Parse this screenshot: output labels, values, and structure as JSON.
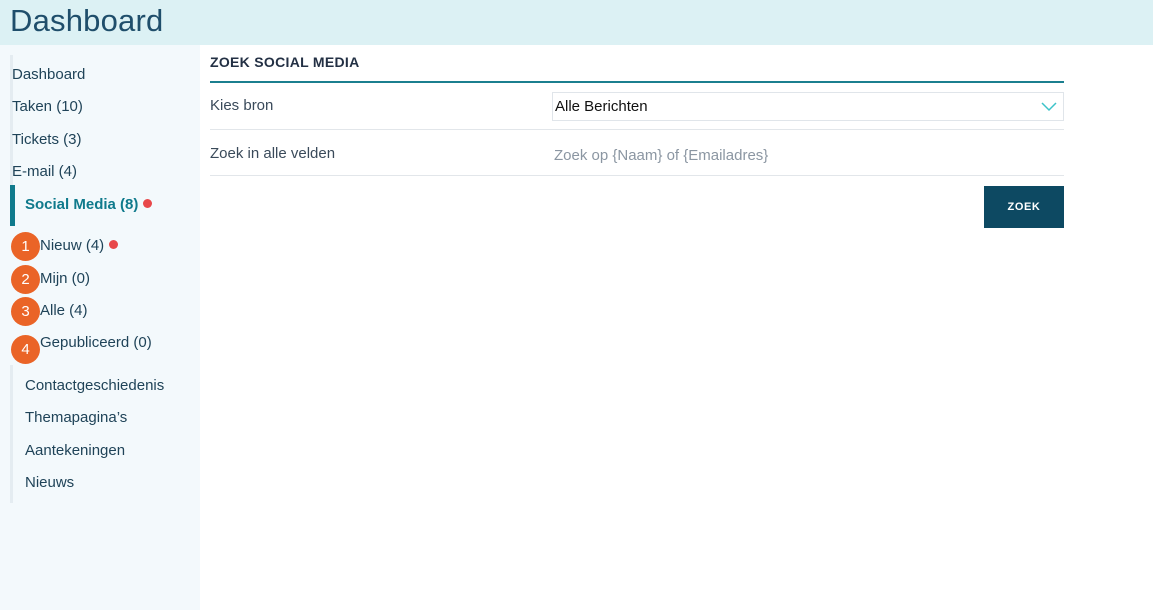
{
  "header": {
    "title": "Dashboard"
  },
  "sidebar": {
    "items_top": [
      {
        "label": "Dashboard"
      },
      {
        "label": "Taken (10)"
      },
      {
        "label": "Tickets (3)"
      },
      {
        "label": "E-mail (4)"
      }
    ],
    "active_item": {
      "label": "Social Media (8)",
      "has_notification": true
    },
    "sub_items": [
      {
        "marker": "1",
        "label": "Nieuw (4)",
        "has_notification": true
      },
      {
        "marker": "2",
        "label": "Mijn (0)",
        "has_notification": false
      },
      {
        "marker": "3",
        "label": "Alle (4)",
        "has_notification": false
      },
      {
        "marker": "4",
        "label": "Gepubliceerd (0)",
        "has_notification": false
      }
    ],
    "items_bottom": [
      {
        "label": "Contactgeschiedenis"
      },
      {
        "label": "Themapagina’s"
      },
      {
        "label": "Aantekeningen"
      },
      {
        "label": "Nieuws"
      }
    ]
  },
  "main": {
    "section_title": "ZOEK SOCIAL MEDIA",
    "source_label": "Kies bron",
    "source_value": "Alle Berichten",
    "search_label": "Zoek in alle velden",
    "search_placeholder": "Zoek op {Naam} of {Emailadres}",
    "search_value": "",
    "search_button": "ZOEK"
  },
  "colors": {
    "header_bg": "#dcf1f4",
    "sidebar_bg": "#f3f9fc",
    "accent": "#0f7a8c",
    "notification": "#e8484a",
    "marker": "#ea6427",
    "button_bg": "#0d4962"
  },
  "icons": {
    "notification": "notification-dot-icon",
    "dropdown": "chevron-down-icon"
  }
}
